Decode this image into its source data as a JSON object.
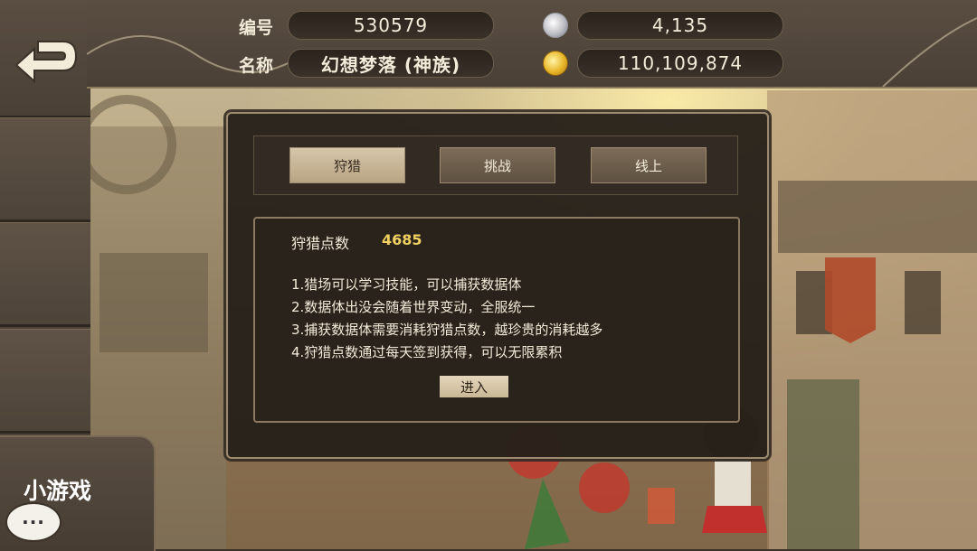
{
  "header": {
    "id_label": "编号",
    "id_value": "530579",
    "name_label": "名称",
    "name_value": "幻想梦落 (神族)",
    "crystal_value": "4,135",
    "gold_value": "110,109,874",
    "crystal_icon": "crystal-icon",
    "gold_icon": "gold-coin-icon"
  },
  "sidebar": {
    "back_icon": "back-arrow-icon",
    "minigame_label": "小游戏",
    "chat_text": "···"
  },
  "tabs": [
    {
      "label": "狩猎",
      "active": true
    },
    {
      "label": "挑战",
      "active": false
    },
    {
      "label": "线上",
      "active": false
    }
  ],
  "hunt": {
    "points_label": "狩猎点数",
    "points_value": "4685",
    "rules": [
      "1.猎场可以学习技能，可以捕获数据体",
      "2.数据体出没会随着世界变动，全服统一",
      "3.捕获数据体需要消耗狩猎点数，越珍贵的消耗越多",
      "4.狩猎点数通过每天签到获得，可以无限累积"
    ],
    "enter_label": "进入"
  },
  "colors": {
    "accent_gold": "#f0d060",
    "panel_bg": "#2a231c",
    "frame": "#9c8a70"
  }
}
